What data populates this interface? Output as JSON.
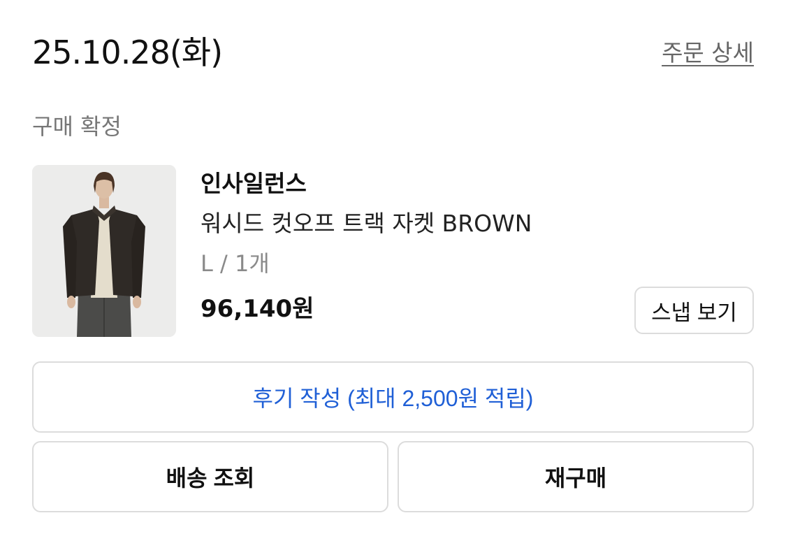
{
  "order": {
    "date": "25.10.28(화)",
    "detail_link": "주문 상세",
    "status": "구매 확정"
  },
  "product": {
    "image_icon": "product-photo-jacket",
    "brand": "인사일런스",
    "name": "워시드 컷오프 트랙 자켓 BROWN",
    "option": "L / 1개",
    "price": "96,140원",
    "snap_label": "스냅 보기"
  },
  "actions": {
    "review_label": "후기 작성 (최대 2,500원 적립)",
    "delivery_label": "배송 조회",
    "reorder_label": "재구매"
  },
  "colors": {
    "accent_blue": "#1f5fd6",
    "border": "#dcdcdc",
    "muted_text": "#777777"
  }
}
